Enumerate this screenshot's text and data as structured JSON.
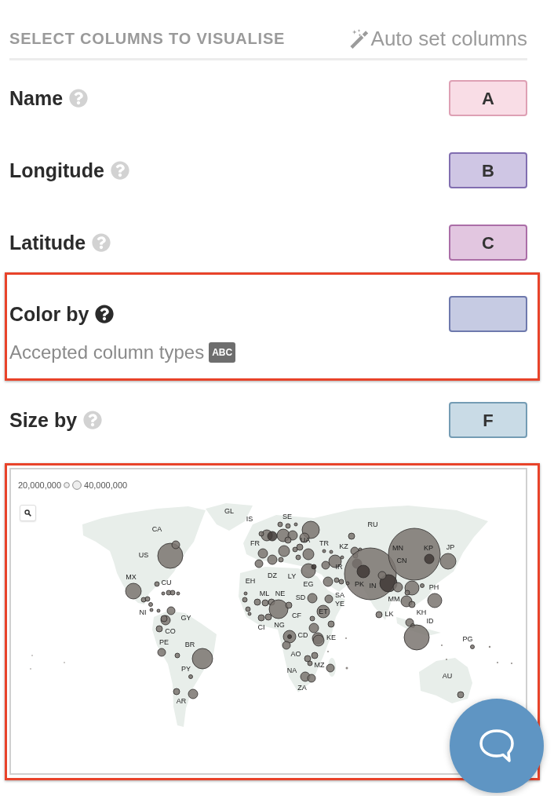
{
  "header": {
    "title": "SELECT COLUMNS TO VISUALISE",
    "auto_set_link": "Auto set columns"
  },
  "columns": [
    {
      "label": "Name",
      "slot": "A",
      "color": "#f9dde6",
      "highlighted": false
    },
    {
      "label": "Longitude",
      "slot": "B",
      "color": "#cfc6e4",
      "highlighted": false
    },
    {
      "label": "Latitude",
      "slot": "C",
      "color": "#e2c6e0",
      "highlighted": false
    },
    {
      "label": "Color by",
      "color": "#c6cbe3",
      "highlighted": true,
      "accepted_types_label": "Accepted column types",
      "accepted_types": [
        "ABC"
      ]
    },
    {
      "label": "Size by",
      "slot": "F",
      "color": "#c9dbe6",
      "highlighted": false
    }
  ],
  "map": {
    "highlighted": true,
    "legend": {
      "min_label": "20,000,000",
      "max_label": "40,000,000"
    },
    "country_labels": [
      "CA",
      "GL",
      "IS",
      "SE",
      "RU",
      "US",
      "FR",
      "UA",
      "KZ",
      "MN",
      "KP",
      "JP",
      "TR",
      "IR",
      "CN",
      "PK",
      "MX",
      "CU",
      "EH",
      "DZ",
      "LY",
      "EG",
      "IN",
      "MM",
      "ML",
      "NE",
      "SD",
      "SA",
      "YE",
      "PH",
      "NI",
      "KH",
      "CI",
      "NG",
      "CF",
      "ET",
      "LK",
      "CO",
      "GY",
      "KE",
      "ID",
      "CD",
      "PG",
      "PE",
      "BR",
      "AO",
      "MZ",
      "NA",
      "PY",
      "AU",
      "ZA",
      "AR"
    ]
  }
}
